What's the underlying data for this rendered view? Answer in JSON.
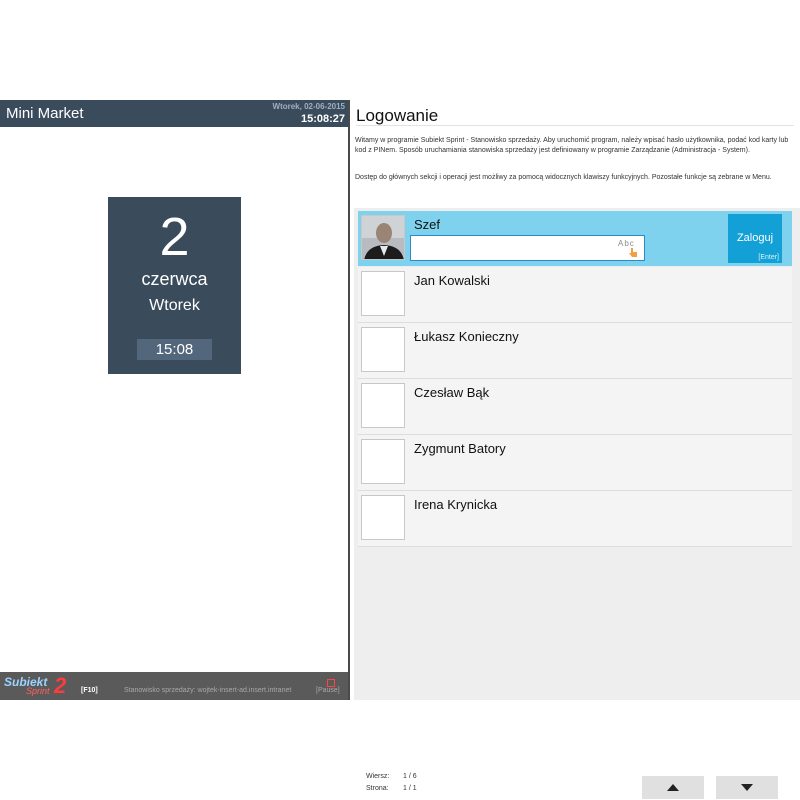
{
  "left": {
    "app_title": "Mini Market",
    "header_date": "Wtorek, 02-06-2015",
    "header_time": "15:08:27",
    "date_tile": {
      "day": "2",
      "month": "czerwca",
      "weekday": "Wtorek",
      "time": "15:08"
    },
    "footer": {
      "logo_word": "Subiekt",
      "logo_sprint": "Sprint",
      "logo_number": "2",
      "f10_label": "[F10]",
      "station_text": "Stanowisko sprzedaży: wojtek-insert-ad.insert.intranet",
      "pause_label": "[Pause]"
    }
  },
  "right": {
    "title": "Logowanie",
    "description_1": "Witamy w programie Subiekt Sprint - Stanowisko sprzedaży. Aby uruchomić program, należy wpisać hasło użytkownika, podać kod karty lub kod z PINem. Sposób uruchamiania stanowiska sprzedaży jest definiowany w programie Zarządzanie (Administracja - System).",
    "description_2": "Dostęp do głównych sekcji i operacji jest możliwy za pomocą widocznych klawiszy funkcyjnych. Pozostałe funkcje są zebrane w Menu.",
    "users": [
      {
        "name": "Szef"
      },
      {
        "name": "Jan Kowalski"
      },
      {
        "name": "Łukasz Konieczny"
      },
      {
        "name": "Czesław Bąk"
      },
      {
        "name": "Zygmunt Batory"
      },
      {
        "name": "Irena Krynicka"
      }
    ],
    "abc_icon_text": "Abc",
    "login_button": {
      "label": "Zaloguj",
      "key": "[Enter]"
    },
    "status": {
      "row_label": "Wiersz:",
      "row_value": "1 / 6",
      "page_label": "Strona:",
      "page_value": "1 / 1"
    }
  },
  "colors": {
    "header": "#3a4b5c",
    "selected_row": "#7ed2ee",
    "login_button": "#12a0d6"
  }
}
